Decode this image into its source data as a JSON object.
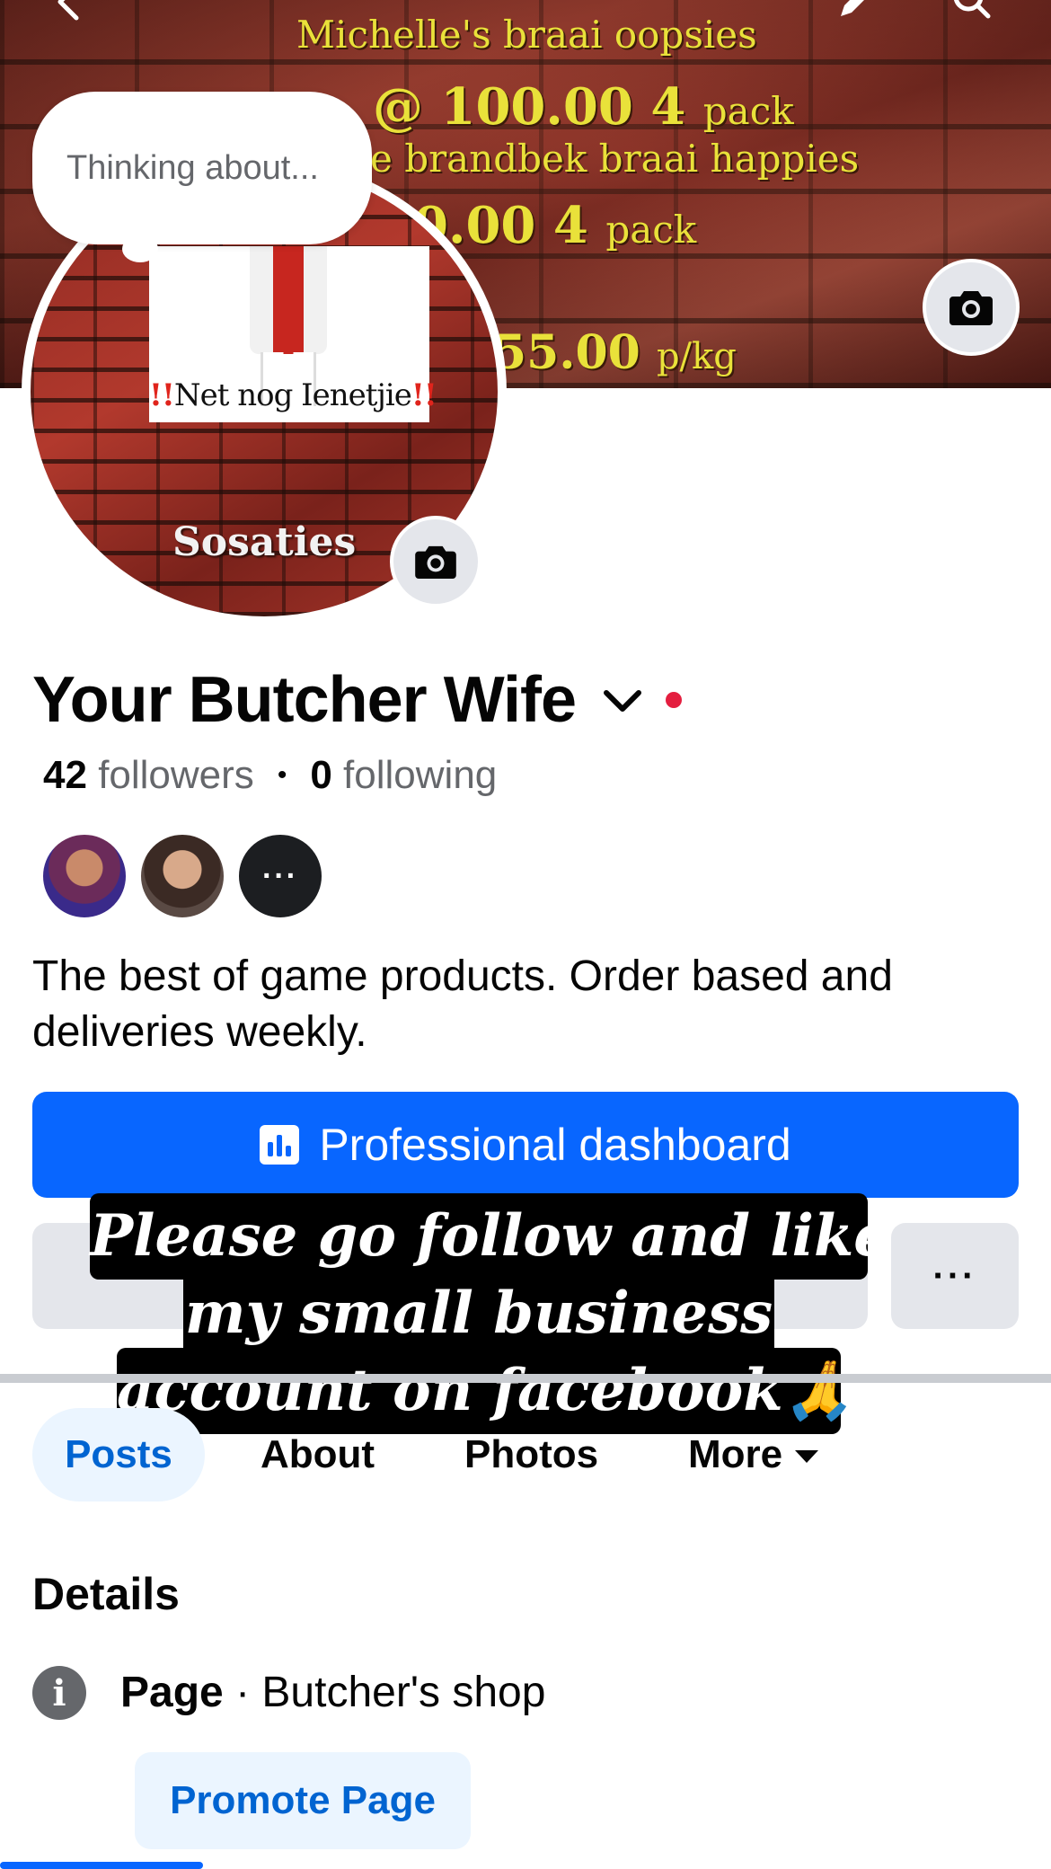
{
  "cover": {
    "lines": [
      {
        "main": "Michelle's braai oopsies"
      },
      {
        "main": "@ 100.00 4",
        "small": "pack"
      },
      {
        "main": "e brandbek braai happies"
      },
      {
        "main": "0.00 4",
        "small": "pack"
      },
      {
        "main": "55.00",
        "small": "p/kg"
      }
    ]
  },
  "avatar": {
    "banner_bang_left": "!!",
    "banner_text": "Net nog Ienetjie",
    "banner_bang_right": "!!",
    "sosaties": "Sosaties"
  },
  "thought_bubble": {
    "text": "Thinking about..."
  },
  "profile": {
    "name": "Your Butcher Wife",
    "followers_count": "42",
    "followers_label": "followers",
    "separator": "•",
    "following_count": "0",
    "following_label": "following",
    "friends_more": "···",
    "bio": "The best of game products. Order based and deliveries weekly."
  },
  "buttons": {
    "professional_dashboard": "Professional dashboard",
    "more": "···",
    "promote_page": "Promote Page"
  },
  "caption": {
    "line1": "Please go follow and like",
    "line2": "my small business",
    "line3": "account on facebook🙏"
  },
  "tabs": [
    {
      "label": "Posts",
      "active": true
    },
    {
      "label": "About"
    },
    {
      "label": "Photos"
    },
    {
      "label": "More"
    }
  ],
  "details": {
    "title": "Details",
    "info_icon": "i",
    "page_label": "Page",
    "page_sep": " · ",
    "page_category": "Butcher's shop"
  },
  "colors": {
    "accent": "#0866ff",
    "accent_text": "#0064d1",
    "accent_light": "#ebf5ff",
    "secondary_button": "#e4e6eb",
    "muted_text": "#65676b",
    "notification_dot": "#e41e3f"
  },
  "icons": {
    "back": "back-arrow-icon",
    "edit": "edit-pencil-icon",
    "search": "search-icon",
    "camera": "camera-icon",
    "chevron": "chevron-down-icon",
    "dashboard": "bar-chart-icon",
    "info": "info-icon"
  }
}
